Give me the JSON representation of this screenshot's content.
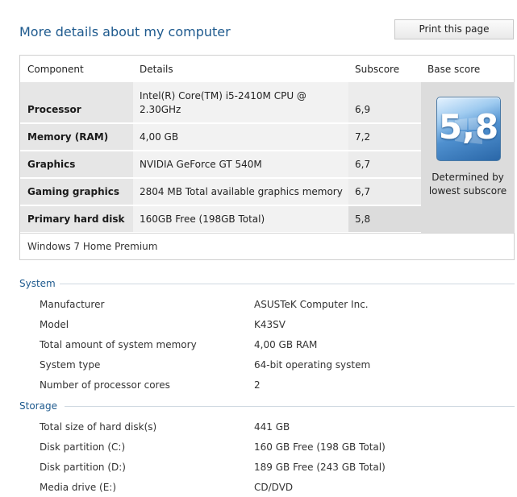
{
  "header": {
    "title": "More details about my computer",
    "print_label": "Print this page"
  },
  "score_table": {
    "columns": [
      "Component",
      "Details",
      "Subscore",
      "Base score"
    ],
    "rows": [
      {
        "component": "Processor",
        "details_l1": "Intel(R) Core(TM) i5-2410M CPU @",
        "details_l2": "2.30GHz",
        "subscore": "6,9"
      },
      {
        "component": "Memory (RAM)",
        "details_l1": "4,00 GB",
        "details_l2": "",
        "subscore": "7,2"
      },
      {
        "component": "Graphics",
        "details_l1": "NVIDIA GeForce GT 540M",
        "details_l2": "",
        "subscore": "6,7"
      },
      {
        "component": "Gaming graphics",
        "details_l1": "2804 MB Total available graphics memory",
        "details_l2": "",
        "subscore": "6,7"
      },
      {
        "component": "Primary hard disk",
        "details_l1": "160GB Free (198GB Total)",
        "details_l2": "",
        "subscore": "5,8"
      }
    ],
    "base_score": "5,8",
    "base_note_l1": "Determined by",
    "base_note_l2": "lowest subscore",
    "edition": "Windows 7 Home Premium"
  },
  "system": {
    "title": "System",
    "items": [
      {
        "label": "Manufacturer",
        "value": "ASUSTeK Computer Inc."
      },
      {
        "label": "Model",
        "value": "K43SV"
      },
      {
        "label": "Total amount of system memory",
        "value": "4,00 GB RAM"
      },
      {
        "label": "System type",
        "value": "64-bit operating system"
      },
      {
        "label": "Number of processor cores",
        "value": "2"
      }
    ]
  },
  "storage": {
    "title": "Storage",
    "items": [
      {
        "label": "Total size of hard disk(s)",
        "value": "441 GB"
      },
      {
        "label": "Disk partition (C:)",
        "value": "160 GB Free (198 GB Total)"
      },
      {
        "label": "Disk partition (D:)",
        "value": "189 GB Free (243 GB Total)"
      },
      {
        "label": "Media drive (E:)",
        "value": "CD/DVD"
      }
    ]
  }
}
